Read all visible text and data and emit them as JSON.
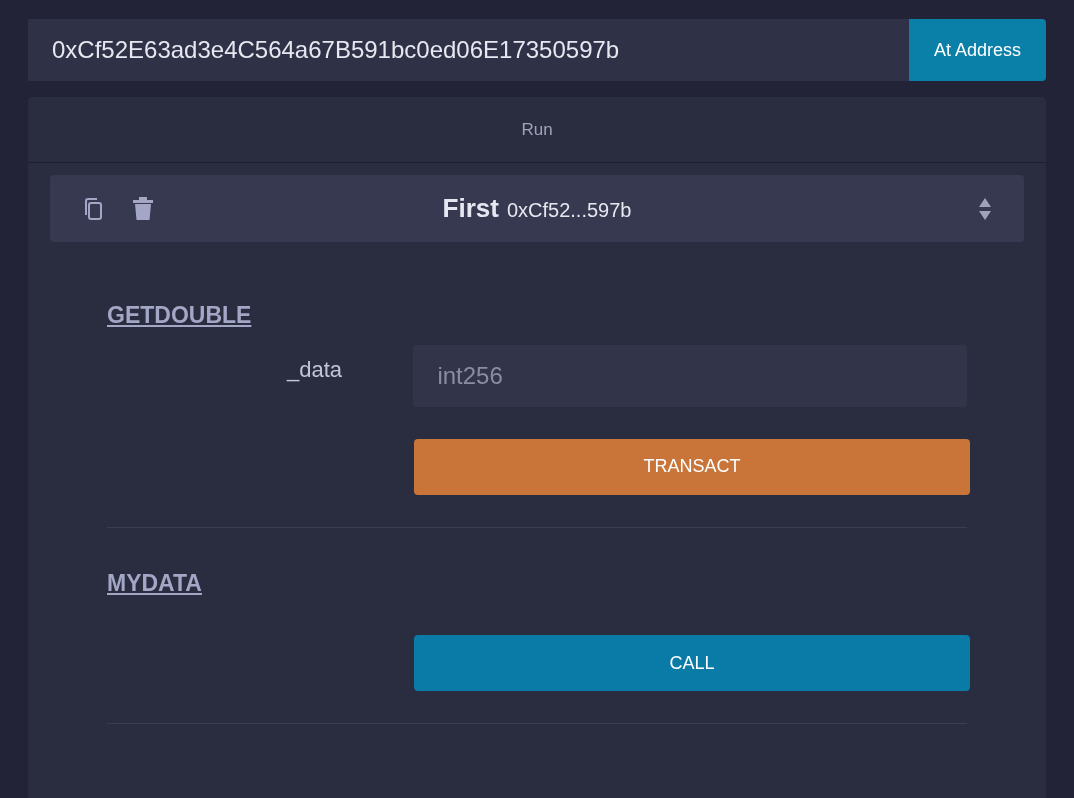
{
  "address_field": {
    "value": "0xCf52E63ad3e4C564a67B591bc0ed06E17350597b"
  },
  "at_address_button": "At Address",
  "panel": {
    "title": "Run",
    "instance": {
      "name": "First",
      "address": "0xCf52...597b"
    },
    "functions": [
      {
        "name": "GETDOUBLE",
        "kind": "transact",
        "inputs": [
          {
            "label": "_data",
            "placeholder": "int256"
          }
        ],
        "button": "TRANSACT"
      },
      {
        "name": "MYDATA",
        "kind": "call",
        "button": "CALL"
      }
    ]
  }
}
